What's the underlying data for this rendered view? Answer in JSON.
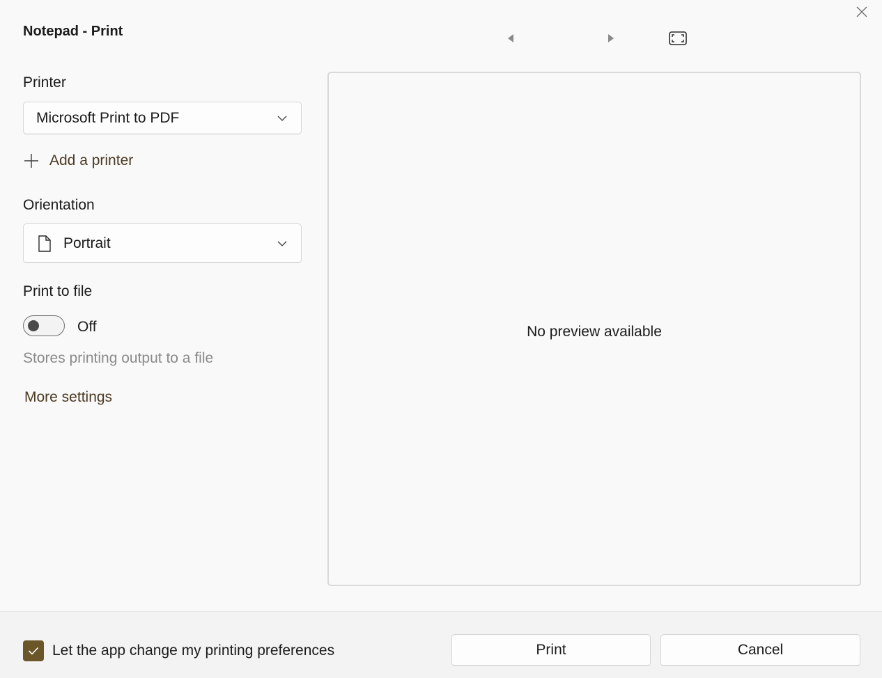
{
  "dialog": {
    "title": "Notepad - Print"
  },
  "printer": {
    "label": "Printer",
    "selected": "Microsoft Print to PDF",
    "add_printer_label": "Add a printer"
  },
  "orientation": {
    "label": "Orientation",
    "selected": "Portrait",
    "icon": "page-icon"
  },
  "print_to_file": {
    "label": "Print to file",
    "state": "Off",
    "hint": "Stores printing output to a file"
  },
  "more_settings_label": "More settings",
  "preview": {
    "message": "No preview available"
  },
  "footer": {
    "preferences_checkbox_label": "Let the app change my printing preferences",
    "preferences_checked": true,
    "print_label": "Print",
    "cancel_label": "Cancel"
  },
  "icons": {
    "close": "close-icon",
    "prev": "previous-page-icon",
    "next": "next-page-icon",
    "fit": "fit-to-page-icon"
  },
  "colors": {
    "accent": "#6a5629",
    "link": "#4b3a22",
    "background": "#f9f9f9",
    "footer_background": "#f3f3f3",
    "hint_text": "#8a8a8a"
  }
}
